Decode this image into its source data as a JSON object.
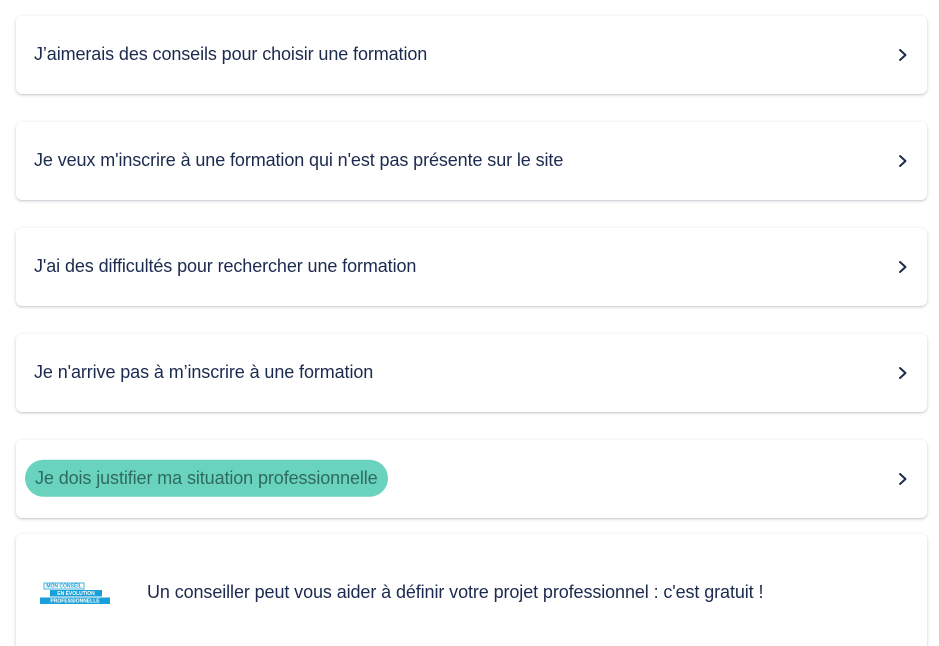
{
  "items": [
    {
      "label": "J’aimerais des conseils pour choisir une formation"
    },
    {
      "label": "Je veux m'inscrire à une formation qui n'est pas présente sur le site"
    },
    {
      "label": "J'ai des difficultés pour rechercher une formation"
    },
    {
      "label": "Je n'arrive pas à m’inscrire à une formation"
    },
    {
      "label": "Je dois justifier ma situation professionnelle",
      "highlighted": true
    }
  ],
  "promo": {
    "logo_lines": [
      "MON CONSEIL",
      "EN ÉVOLUTION",
      "PROFESSIONNELLE"
    ],
    "text": "Un conseiller peut vous aider à définir votre projet professionnel : c'est gratuit !"
  },
  "colors": {
    "text": "#1b2a4e",
    "highlight": "#69d3be",
    "logo_blue": "#1aa0d8"
  }
}
